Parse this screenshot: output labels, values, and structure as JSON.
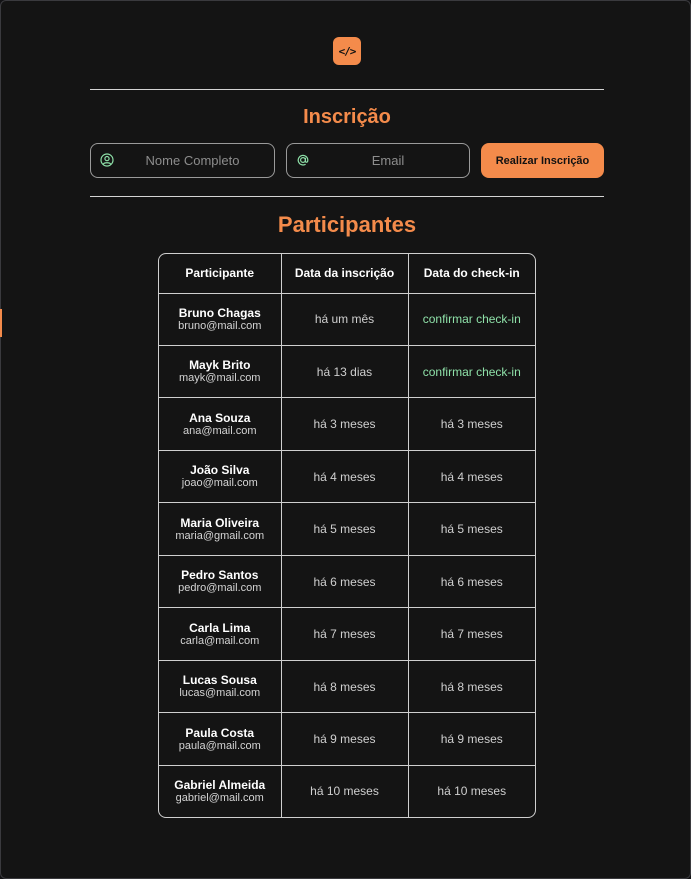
{
  "logo": {
    "icon": "code-icon",
    "text": "</>",
    "color": "#f48b4b"
  },
  "form": {
    "title": "Inscrição",
    "name_placeholder": "Nome Completo",
    "email_placeholder": "Email",
    "name_icon": "user-circle-icon",
    "email_icon": "at-sign-icon",
    "submit_label": "Realizar Inscrição"
  },
  "participants": {
    "title": "Participantes",
    "headers": [
      "Participante",
      "Data da inscrição",
      "Data do check-in"
    ],
    "rows": [
      {
        "name": "Bruno Chagas",
        "email": "bruno@mail.com",
        "registered": "há um mês",
        "checkin": "confirmar check-in",
        "checkin_pending": true
      },
      {
        "name": "Mayk Brito",
        "email": "mayk@mail.com",
        "registered": "há 13 dias",
        "checkin": "confirmar check-in",
        "checkin_pending": true
      },
      {
        "name": "Ana Souza",
        "email": "ana@mail.com",
        "registered": "há 3 meses",
        "checkin": "há 3 meses",
        "checkin_pending": false
      },
      {
        "name": "João Silva",
        "email": "joao@mail.com",
        "registered": "há 4 meses",
        "checkin": "há 4 meses",
        "checkin_pending": false
      },
      {
        "name": "Maria Oliveira",
        "email": "maria@gmail.com",
        "registered": "há 5 meses",
        "checkin": "há 5 meses",
        "checkin_pending": false
      },
      {
        "name": "Pedro Santos",
        "email": "pedro@mail.com",
        "registered": "há 6 meses",
        "checkin": "há 6 meses",
        "checkin_pending": false
      },
      {
        "name": "Carla Lima",
        "email": "carla@mail.com",
        "registered": "há 7 meses",
        "checkin": "há 7 meses",
        "checkin_pending": false
      },
      {
        "name": "Lucas Sousa",
        "email": "lucas@mail.com",
        "registered": "há 8 meses",
        "checkin": "há 8 meses",
        "checkin_pending": false
      },
      {
        "name": "Paula Costa",
        "email": "paula@mail.com",
        "registered": "há 9 meses",
        "checkin": "há 9 meses",
        "checkin_pending": false
      },
      {
        "name": "Gabriel Almeida",
        "email": "gabriel@mail.com",
        "registered": "há 10 meses",
        "checkin": "há 10 meses",
        "checkin_pending": false
      }
    ]
  },
  "colors": {
    "accent": "#f48b4b",
    "background": "#141414",
    "checkin_link": "#8ee0a8",
    "icon": "#8ee0a8"
  }
}
